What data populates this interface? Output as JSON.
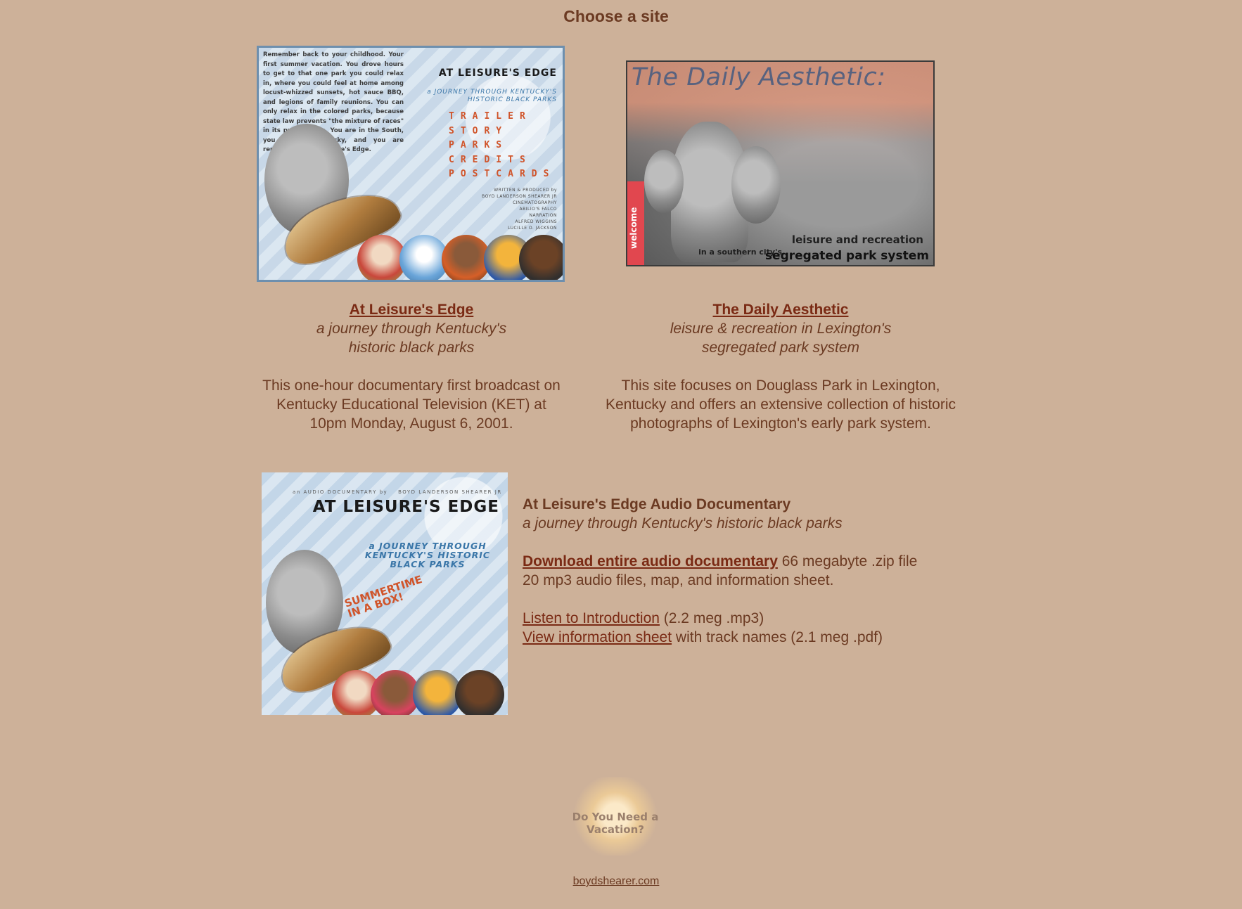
{
  "page": {
    "heading": "Choose a site"
  },
  "sites": [
    {
      "link": "At Leisure's Edge",
      "tagline_1": "a journey through Kentucky's",
      "tagline_2": "historic black parks",
      "description_1": "This one-hour documentary first broadcast on",
      "description_2": "Kentucky Educational Television (KET) at",
      "description_3": "10pm Monday, August 6, 2001.",
      "image": {
        "intro_text": "Remember back to your childhood. Your first summer vacation. You drove hours to get to that one park you could relax in, where you could feel at home among locust-whizzed sunsets, hot sauce BBQ, and legions of family reunions. You can only relax in the colored parks, because state law prevents \"the mixture of races\" in its public parks. You are in the South, you are in Kentucky, and you are remembering At Leisure's Edge.",
        "title": "AT LEISURE'S EDGE",
        "subtitle_1": "a JOURNEY THROUGH KENTUCKY'S",
        "subtitle_2": "HISTORIC BLACK PARKS",
        "menu": [
          "TRAILER",
          "STORY",
          "PARKS",
          "CREDITS",
          "POSTCARDS"
        ],
        "credits_1": "WRITTEN & PRODUCED by",
        "credits_2": "BOYD LANDERSON SHEARER JR",
        "credits_3": "CINEMATOGRAPHY",
        "credits_4": "ABILIO'S FALCO",
        "credits_5": "NARRATION",
        "credits_6": "ALFRED WIGGINS",
        "credits_7": "LUCILLE O. JACKSON"
      }
    },
    {
      "link": "The Daily Aesthetic",
      "tagline_1": "leisure & recreation in Lexington's",
      "tagline_2": "segregated park system",
      "description_1": "This site focuses on Douglass Park in Lexington,",
      "description_2": "Kentucky and offers an extensive collection of historic",
      "description_3": "photographs of Lexington's early park system.",
      "image": {
        "title": "The Daily Aesthetic:",
        "welcome": "welcome",
        "line_1": "leisure and recreation",
        "line_2": "in a southern city's",
        "line_3": "segregated park system"
      }
    }
  ],
  "audio": {
    "title": "At Leisure's Edge Audio Documentary",
    "tagline": "a journey through Kentucky's historic black parks",
    "download_link": "Download entire audio documentary",
    "download_info": " 66 megabyte .zip file",
    "contents": "20 mp3 audio files, map, and information sheet.",
    "listen_link": "Listen to Introduction",
    "listen_info": " (2.2 meg .mp3)",
    "sheet_link": "View information sheet",
    "sheet_info": " with track names (2.1 meg .pdf)",
    "image": {
      "top_line": "an AUDIO DOCUMENTARY by",
      "top_name": "BOYD LANDERSON SHEARER JR",
      "title": "AT LEISURE'S EDGE",
      "subtitle": "a JOURNEY THROUGH KENTUCKY'S HISTORIC BLACK PARKS",
      "badge_1": "SUMMERTIME",
      "badge_2": "IN A BOX!"
    }
  },
  "vacation": {
    "label": "Do You Need a Vacation?"
  },
  "footer": {
    "link": "boydshearer.com"
  },
  "colors": {
    "background": "#cdb199",
    "text": "#6b3a22",
    "link": "#7a2a14"
  }
}
